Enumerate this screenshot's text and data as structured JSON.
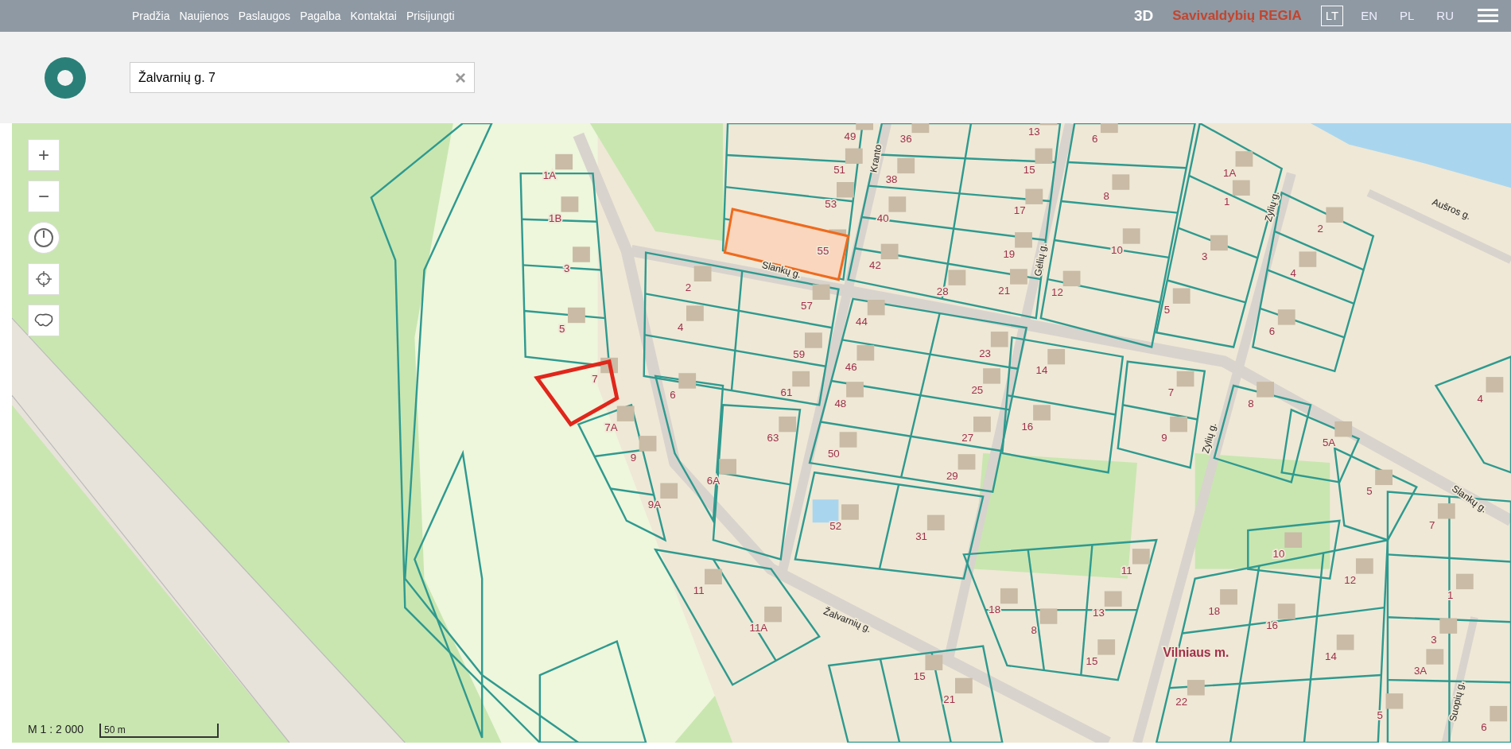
{
  "topbar": {
    "nav": [
      "Pradžia",
      "Naujienos",
      "Paslaugos",
      "Pagalba",
      "Kontaktai",
      "Prisijungti"
    ],
    "mode_3d": "3D",
    "brand": "Savivaldybių REGIA",
    "languages": [
      {
        "label": "LT",
        "selected": true
      },
      {
        "label": "EN",
        "selected": false
      },
      {
        "label": "PL",
        "selected": false
      },
      {
        "label": "RU",
        "selected": false
      }
    ]
  },
  "search": {
    "value": "Žalvarnių g. 7",
    "clear": "×"
  },
  "map_controls": [
    {
      "kind": "zoom-in",
      "text": "+"
    },
    {
      "kind": "zoom-out",
      "text": "−"
    },
    {
      "kind": "history"
    },
    {
      "kind": "locate"
    },
    {
      "kind": "extent"
    }
  ],
  "map": {
    "labels": [
      {
        "kind": "parcel",
        "text": "49"
      },
      {
        "kind": "parcel",
        "text": "36"
      },
      {
        "kind": "parcel",
        "text": "13"
      },
      {
        "kind": "parcel",
        "text": "6"
      },
      {
        "kind": "street",
        "text": "Kranto"
      },
      {
        "kind": "parcel",
        "text": "1A"
      },
      {
        "kind": "parcel",
        "text": "51"
      },
      {
        "kind": "parcel",
        "text": "38"
      },
      {
        "kind": "parcel",
        "text": "15"
      },
      {
        "kind": "parcel",
        "text": "1A"
      },
      {
        "kind": "parcel",
        "text": "1B"
      },
      {
        "kind": "parcel",
        "text": "53"
      },
      {
        "kind": "parcel",
        "text": "40"
      },
      {
        "kind": "parcel",
        "text": "17"
      },
      {
        "kind": "parcel",
        "text": "8"
      },
      {
        "kind": "parcel",
        "text": "1"
      },
      {
        "kind": "street",
        "text": "Zylių g."
      },
      {
        "kind": "parcel",
        "text": "2"
      },
      {
        "kind": "street",
        "text": "Aušros g."
      },
      {
        "kind": "parcel",
        "text": "3"
      },
      {
        "kind": "street",
        "text": "Slankų g."
      },
      {
        "kind": "parcel",
        "text": "55"
      },
      {
        "kind": "parcel",
        "text": "42"
      },
      {
        "kind": "parcel",
        "text": "19"
      },
      {
        "kind": "street",
        "text": "Gėlių g."
      },
      {
        "kind": "parcel",
        "text": "10"
      },
      {
        "kind": "parcel",
        "text": "3"
      },
      {
        "kind": "parcel",
        "text": "4"
      },
      {
        "kind": "parcel",
        "text": "2"
      },
      {
        "kind": "parcel",
        "text": "28"
      },
      {
        "kind": "parcel",
        "text": "21"
      },
      {
        "kind": "parcel",
        "text": "12"
      },
      {
        "kind": "parcel",
        "text": "57"
      },
      {
        "kind": "parcel",
        "text": "5"
      },
      {
        "kind": "parcel",
        "text": "5"
      },
      {
        "kind": "parcel",
        "text": "4"
      },
      {
        "kind": "parcel",
        "text": "44"
      },
      {
        "kind": "parcel",
        "text": "6"
      },
      {
        "kind": "parcel",
        "text": "59"
      },
      {
        "kind": "parcel",
        "text": "23"
      },
      {
        "kind": "parcel",
        "text": "46"
      },
      {
        "kind": "parcel",
        "text": "14"
      },
      {
        "kind": "parcel",
        "text": "7"
      },
      {
        "kind": "parcel",
        "text": "6"
      },
      {
        "kind": "parcel",
        "text": "61"
      },
      {
        "kind": "parcel",
        "text": "48"
      },
      {
        "kind": "parcel",
        "text": "25"
      },
      {
        "kind": "parcel",
        "text": "7"
      },
      {
        "kind": "parcel",
        "text": "8"
      },
      {
        "kind": "parcel",
        "text": "4"
      },
      {
        "kind": "parcel",
        "text": "7A"
      },
      {
        "kind": "parcel",
        "text": "63"
      },
      {
        "kind": "parcel",
        "text": "27"
      },
      {
        "kind": "parcel",
        "text": "16"
      },
      {
        "kind": "parcel",
        "text": "9"
      },
      {
        "kind": "street",
        "text": "Zylių g."
      },
      {
        "kind": "parcel",
        "text": "5A"
      },
      {
        "kind": "parcel",
        "text": "9"
      },
      {
        "kind": "parcel",
        "text": "50"
      },
      {
        "kind": "parcel",
        "text": "6A"
      },
      {
        "kind": "parcel",
        "text": "29"
      },
      {
        "kind": "parcel",
        "text": "9A"
      },
      {
        "kind": "parcel",
        "text": "5"
      },
      {
        "kind": "street",
        "text": "Slankų g."
      },
      {
        "kind": "parcel",
        "text": "52"
      },
      {
        "kind": "parcel",
        "text": "31"
      },
      {
        "kind": "parcel",
        "text": "7"
      },
      {
        "kind": "parcel",
        "text": "10"
      },
      {
        "kind": "parcel",
        "text": "11"
      },
      {
        "kind": "parcel",
        "text": "12"
      },
      {
        "kind": "parcel",
        "text": "11"
      },
      {
        "kind": "parcel",
        "text": "1"
      },
      {
        "kind": "parcel",
        "text": "11A"
      },
      {
        "kind": "street",
        "text": "Žalvarnių g."
      },
      {
        "kind": "parcel",
        "text": "18"
      },
      {
        "kind": "parcel",
        "text": "8"
      },
      {
        "kind": "parcel",
        "text": "13"
      },
      {
        "kind": "parcel",
        "text": "18"
      },
      {
        "kind": "parcel",
        "text": "16"
      },
      {
        "kind": "parcel",
        "text": "3"
      },
      {
        "kind": "parcel",
        "text": "15"
      },
      {
        "kind": "place",
        "text": "Vilniaus m."
      },
      {
        "kind": "parcel",
        "text": "14"
      },
      {
        "kind": "parcel",
        "text": "3A"
      },
      {
        "kind": "parcel",
        "text": "15"
      },
      {
        "kind": "parcel",
        "text": "21"
      },
      {
        "kind": "parcel",
        "text": "22"
      },
      {
        "kind": "street",
        "text": "Suopių g."
      },
      {
        "kind": "parcel",
        "text": "5"
      },
      {
        "kind": "parcel",
        "text": "6"
      }
    ]
  },
  "scale": {
    "ratio": "M 1 : 2 000",
    "bar_label": "50 m"
  }
}
